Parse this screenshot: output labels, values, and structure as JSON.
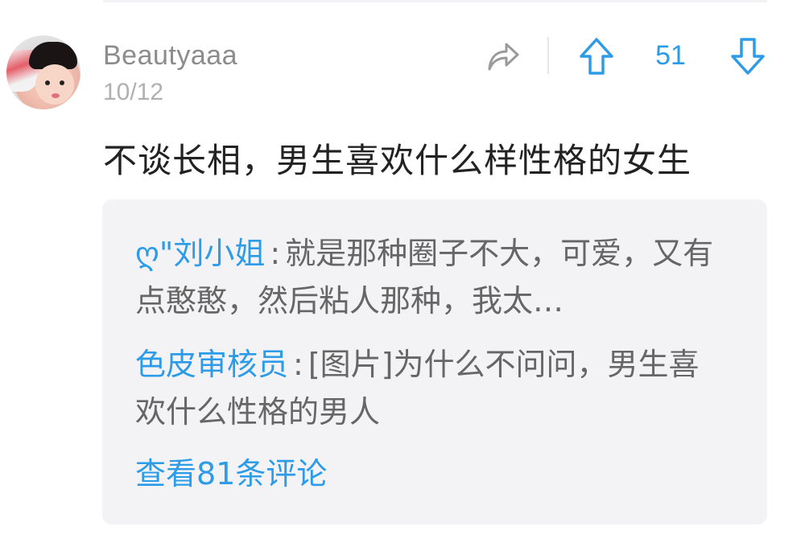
{
  "post": {
    "username": "Beautyaaa",
    "date": "10/12",
    "title": "不谈长相，男生喜欢什么样性格的女生",
    "vote_count": "51"
  },
  "comments": [
    {
      "author": "ღ\"刘小姐",
      "text": "就是那种圈子不大，可爱，又有点憨憨，然后粘人那种，我太…"
    },
    {
      "author": "色皮审核员",
      "text": "[图片]为什么不问问，男生喜欢什么性格的男人"
    }
  ],
  "view_all_label": "查看81条评论",
  "colors": {
    "accent": "#2d9ce8",
    "username": "#8c8c8c",
    "date": "#b0b0b0",
    "title": "#222222",
    "comment_text": "#666666",
    "comments_bg": "#f3f3f5"
  },
  "icons": {
    "share": "share-arrow-icon",
    "upvote": "arrow-up-icon",
    "downvote": "arrow-down-icon"
  }
}
